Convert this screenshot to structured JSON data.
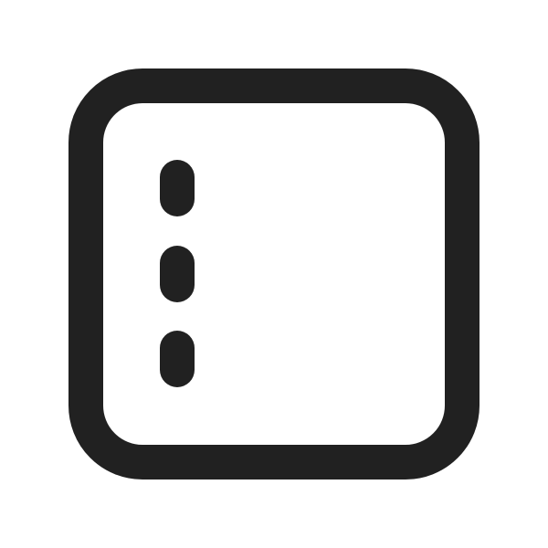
{
  "icon": {
    "name": "panel-left-dots-icon",
    "stroke_color": "#212121",
    "background_color": "#ffffff",
    "dot_count": 3
  }
}
